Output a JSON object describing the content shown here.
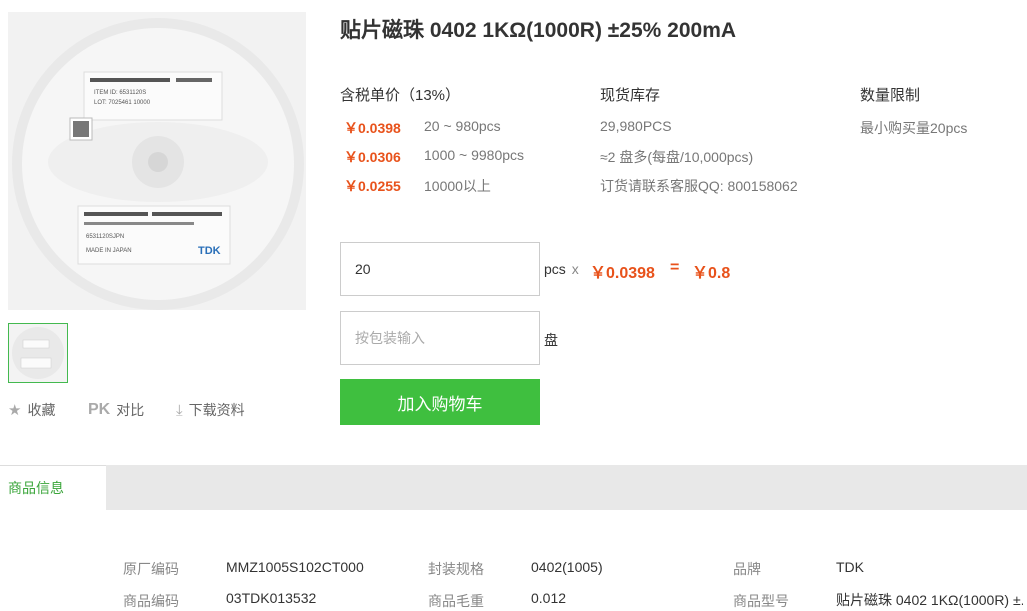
{
  "product": {
    "title": "贴片磁珠 0402 1KΩ(1000R) ±25% 200mA"
  },
  "image": {
    "brand_text": "TDK",
    "label_lines_top": [
      "MMZ1005S102CT000",
      "ITEM ID: 6531120S",
      "LOT: 7025461 10000"
    ],
    "label_lines_bottom": [
      "MMZ1005S102CT000",
      "6531120SJPN",
      "MADE IN JAPAN"
    ]
  },
  "actions": {
    "favorite": "收藏",
    "compare_prefix": "PK",
    "compare": "对比",
    "download": "下载资料"
  },
  "pricing": {
    "header": "含税单价（13%）",
    "tiers": [
      {
        "price": "￥0.0398",
        "range": "20 ~ 980pcs"
      },
      {
        "price": "￥0.0306",
        "range": "1000 ~ 9980pcs"
      },
      {
        "price": "￥0.0255",
        "range": "10000以上"
      }
    ]
  },
  "stock": {
    "header": "现货库存",
    "lines": [
      "29,980PCS",
      "≈2 盘多(每盘/10,000pcs)",
      "订货请联系客服QQ: 800158062"
    ]
  },
  "limit": {
    "header": "数量限制",
    "text": "最小购买量20pcs"
  },
  "order": {
    "qty_value": "20",
    "qty_unit": "pcs",
    "times": "x",
    "unit_price": "￥0.0398",
    "equals": "=",
    "total": "￥0.8",
    "reel_placeholder": "按包装输入",
    "reel_unit": "盘",
    "add_to_cart": "加入购物车"
  },
  "tabs": {
    "active": "商品信息"
  },
  "specs": {
    "rows": [
      [
        {
          "label": "原厂编码",
          "value": "MMZ1005S102CT000"
        },
        {
          "label": "封装规格",
          "value": "0402(1005)"
        },
        {
          "label": "品牌",
          "value": "TDK"
        }
      ],
      [
        {
          "label": "商品编码",
          "value": "03TDK013532"
        },
        {
          "label": "商品毛重",
          "value": "0.012"
        },
        {
          "label": "商品型号",
          "value": "贴片磁珠 0402 1KΩ(1000R) ±."
        }
      ]
    ]
  },
  "colors": {
    "accent_green": "#3fbf3f",
    "price_orange": "#e8521b"
  }
}
